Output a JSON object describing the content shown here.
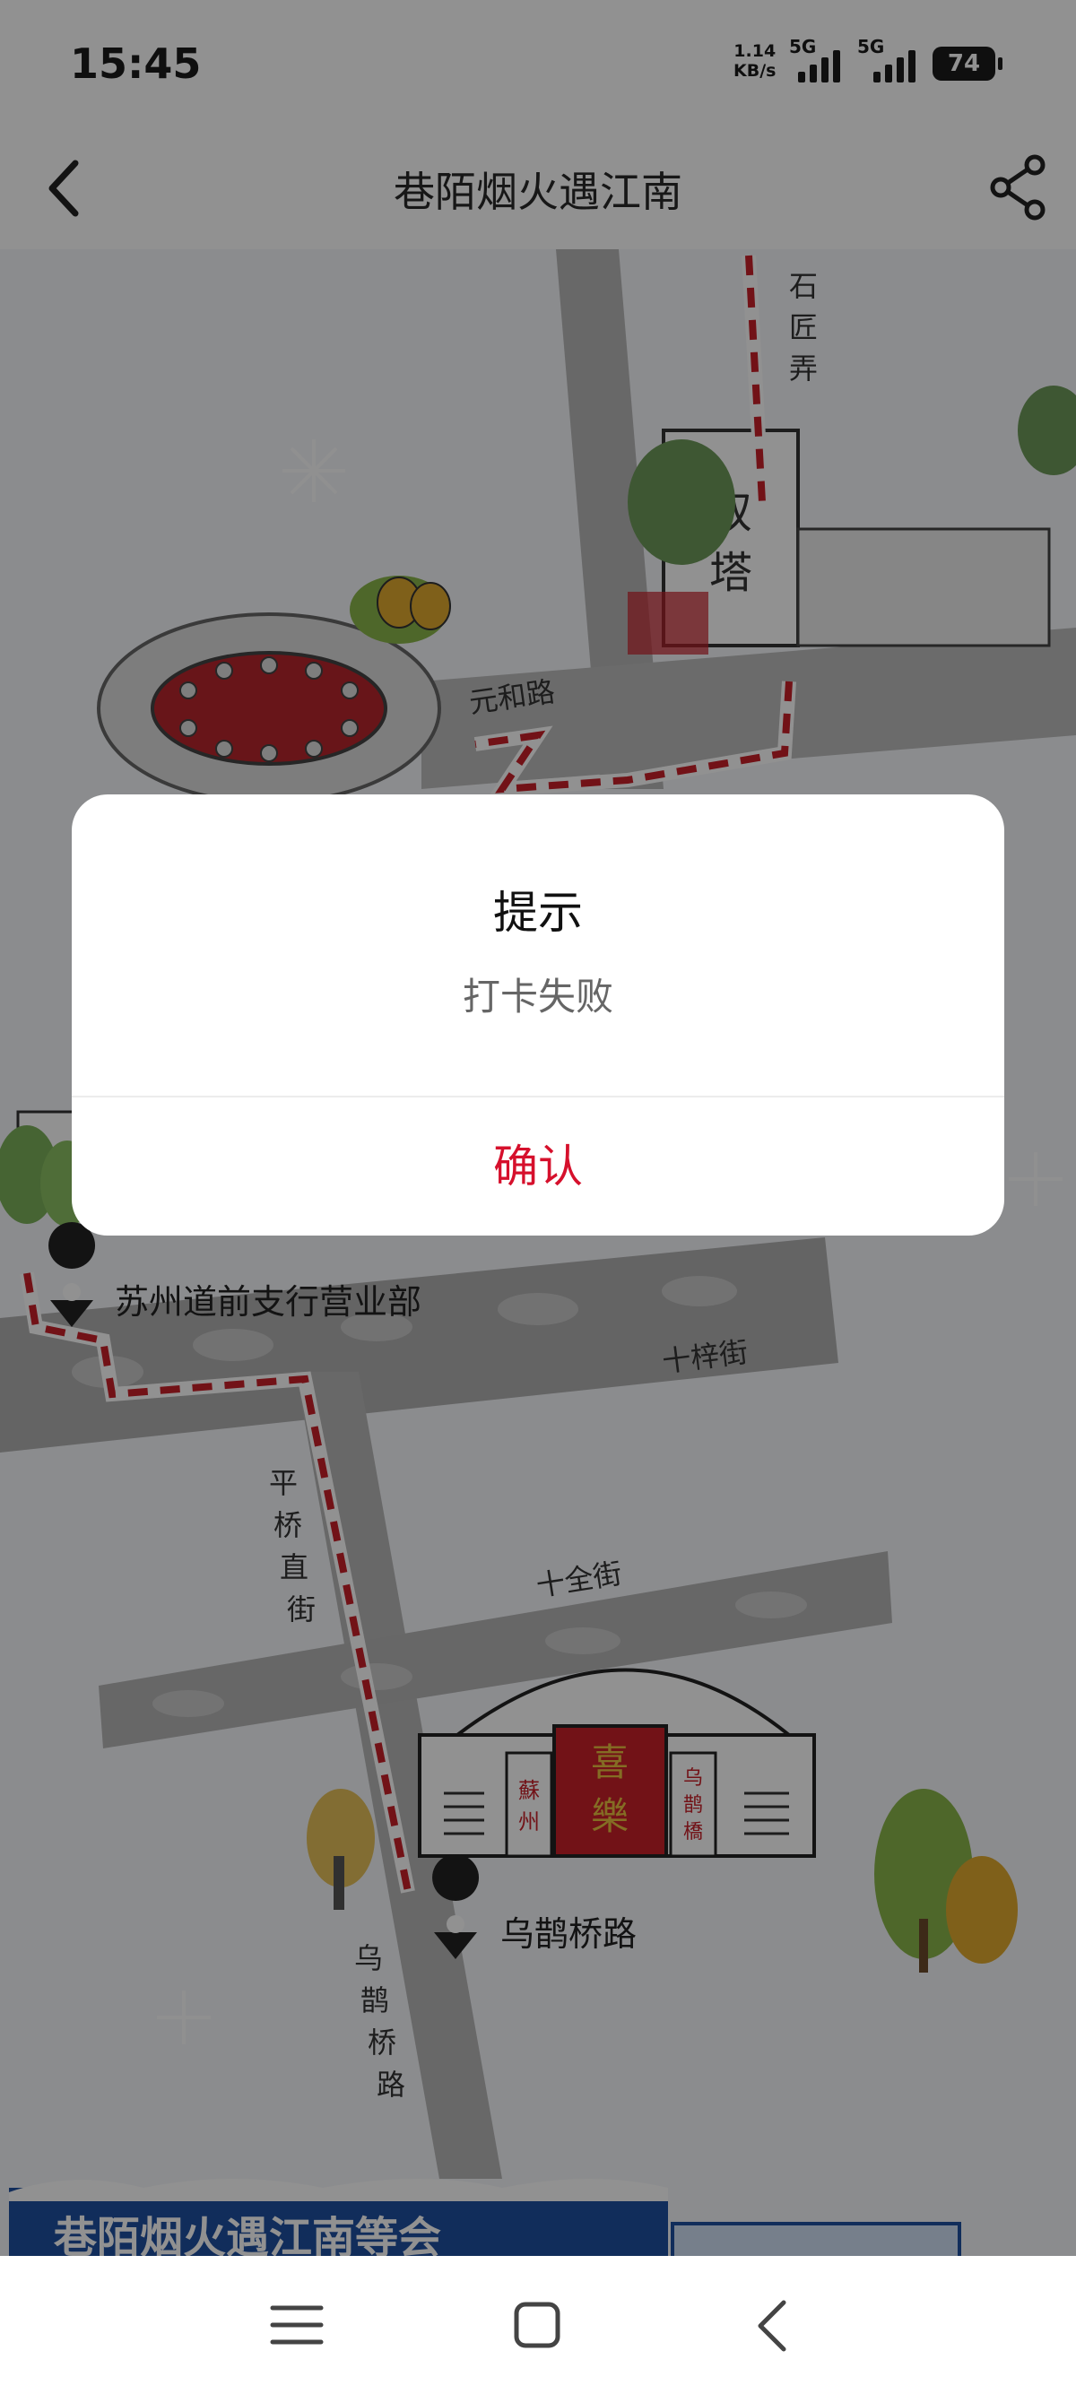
{
  "status_bar": {
    "time": "15:45",
    "net_speed_value": "1.14",
    "net_speed_unit": "KB/s",
    "sim1_label": "5G",
    "sim2_label": "5G",
    "battery": "74"
  },
  "header": {
    "back_icon": "chevron-left-icon",
    "title": "巷陌烟火遇江南",
    "share_icon": "share-icon"
  },
  "map": {
    "streets": {
      "shijiangnong": "石匠弄",
      "yuanhelu": "元和路",
      "shizijie": "十梓街",
      "pingqiaozhijie": "平桥直街",
      "shiquanjie": "十全街",
      "wuqueqiaolu": "乌鹊桥路"
    },
    "landmarks": {
      "twin_towers": "双塔",
      "gate_center": "喜樂",
      "gate_left": "蘇州",
      "gate_right": "乌鹊橋"
    },
    "pins": [
      {
        "label": "苏州道前支行营业部"
      },
      {
        "label": "乌鹊桥路"
      }
    ],
    "banner_text": "巷陌烟火遇江南等会"
  },
  "dialog": {
    "title": "提示",
    "message": "打卡失败",
    "confirm_label": "确认"
  },
  "nav_bar": {
    "icons": [
      "menu-icon",
      "home-icon",
      "back-icon"
    ]
  },
  "colors": {
    "accent_red": "#d6102c",
    "route_red": "#c8202a",
    "road_gray": "#b8b8b8"
  }
}
